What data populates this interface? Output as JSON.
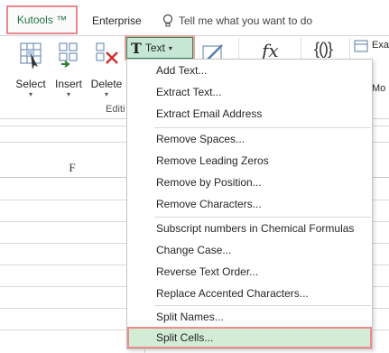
{
  "tabs": {
    "kutools": "Kutools ™",
    "enterprise": "Enterprise",
    "tell_me": "Tell me what you want to do"
  },
  "ribbon": {
    "select_label": "Select",
    "insert_label": "Insert",
    "delete_label": "Delete",
    "group_label": "Editi",
    "text_button": "Text",
    "fx_glyph": "fx",
    "brace_glyph": "{()}",
    "side_labels": [
      "Exa",
      "",
      "Mo"
    ]
  },
  "sheet": {
    "column_header": "F"
  },
  "menu": {
    "items": [
      "Add Text...",
      "Extract Text...",
      "Extract Email Address",
      "Remove Spaces...",
      "Remove Leading Zeros",
      "Remove by Position...",
      "Remove Characters...",
      "Subscript numbers in Chemical Formulas",
      "Change Case...",
      "Reverse Text Order...",
      "Replace Accented Characters...",
      "Split Names...",
      "Split Cells..."
    ]
  },
  "colors": {
    "accent": "#217346",
    "highlight_border": "#ea8d8d",
    "highlight_fill": "#d3ecd6"
  }
}
